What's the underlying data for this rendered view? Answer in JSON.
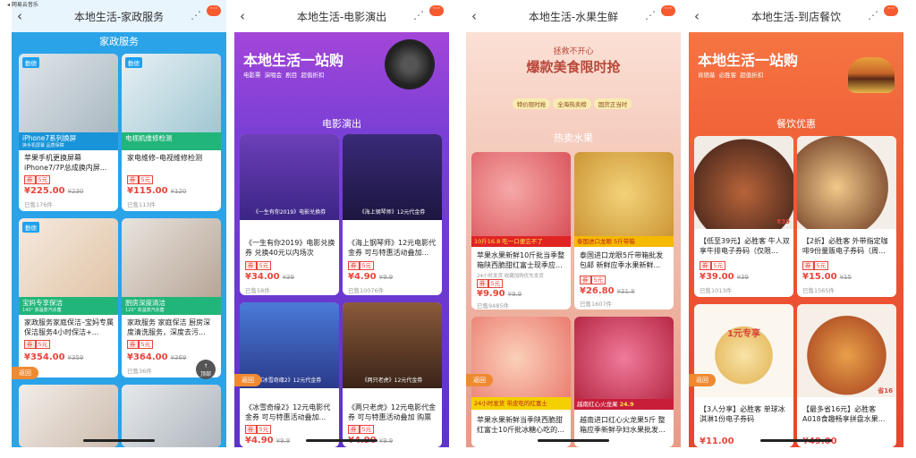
{
  "status_bar": "◂ 网易云音乐",
  "nav_icons": {
    "back": "chevron-left-icon",
    "share": "share-icon",
    "more": "more-icon"
  },
  "common": {
    "back_label": "返回",
    "top_label": "顶部",
    "voucher_tag": "券",
    "voucher_value": "5元"
  },
  "panels": [
    {
      "title": "本地生活-家政服务",
      "section": "家政服务",
      "cards": [
        {
          "bar": "iPhone7系列换屏",
          "bar_sub": "换手机屏幕 品质保障",
          "badge": "勤德",
          "title": "苹果手机更换屏幕iPhone7/7P总成换内屏...",
          "price": "¥225.00",
          "old": "¥230",
          "sold": "已售176件"
        },
        {
          "bar": "电视机维修检测",
          "bar_sub": "",
          "badge": "勤德",
          "title": "家电维修–电视维修检测",
          "price": "¥115.00",
          "old": "¥120",
          "sold": "已售113件"
        },
        {
          "bar": "宝妈专享保洁",
          "bar_sub": "140° 高温蒸汽杀菌",
          "badge": "勤德",
          "title": "家政服务家庭保洁–宝妈专属保洁服务4小时保洁+...",
          "price": "¥354.00",
          "old": "¥359",
          "sold": ""
        },
        {
          "bar": "厨房深度清洁",
          "bar_sub": "120° 高温蒸汽杀菌",
          "badge": "",
          "title": "家政服务 家庭保洁 厨房深度清洗服务，深度去污...",
          "price": "¥364.00",
          "old": "¥369",
          "sold": "已售36件"
        }
      ]
    },
    {
      "title": "本地生活-电影演出",
      "banner": "本地生活一站购",
      "banner_tags": [
        "电影票",
        "演唱会",
        "剧目",
        "超值折扣"
      ],
      "section": "电影演出",
      "cards": [
        {
          "poster": "《一生有你2019》电影兑换券",
          "title": "《一生有你2019》电影兑换券 兑换40元以内场次",
          "price": "¥34.00",
          "old": "¥39",
          "sold": "已售58件"
        },
        {
          "poster": "《海上钢琴师》12元代金券",
          "title": "《海上钢琴师》12元电影代金券 可与特惠活动叠加...",
          "price": "¥4.90",
          "old": "¥9.9",
          "sold": "已售10076件"
        },
        {
          "poster": "《冰雪奇缘2》12元代金券",
          "title": "《冰雪奇缘2》12元电影代金券 可与特惠活动叠加...",
          "price": "¥4.90",
          "old": "¥9.9",
          "sold": ""
        },
        {
          "poster": "《两只老虎》12元代金券",
          "title": "《两只老虎》12元电影代金券 可与特惠活动叠加 购票满...",
          "price": "¥4.90",
          "old": "¥9.9",
          "sold": ""
        }
      ]
    },
    {
      "title": "本地生活-水果生鲜",
      "banner_top": "拯救不开心",
      "banner": "爆款美食限时抢",
      "banner_tags": [
        "特价限时抢",
        "全海热卖榜",
        "国货正当时"
      ],
      "section": "热卖水果",
      "cards": [
        {
          "tag": "10斤16.8 吃一口便忘不了",
          "title": "苹果水果新鲜10斤批当季整箱陕西脆甜红富士现季应...",
          "note": "24小时发货 收藏加购优先发货",
          "price": "¥9.90",
          "old": "¥9.9",
          "sold": "已售9485件"
        },
        {
          "tag": "泰国进口龙眼 5斤带箱",
          "title": "泰国进口龙眼5斤带箱批发包邮 新鲜应季水果新鲜...",
          "note": "",
          "price": "¥26.80",
          "old": "¥31.8",
          "sold": "已售1607件"
        },
        {
          "tag": "24小时发货 带皮吃的红富士",
          "title": "苹果水果新鲜当季陕西脆甜红富士10斤批冰糖心吃的...",
          "note": "",
          "price": "",
          "old": "",
          "sold": ""
        },
        {
          "tag": "越南红心火龙果",
          "title": "越南进口红心火龙果5斤 整箱应季新鲜孕妇水果批发...",
          "note": "",
          "price": "24.9",
          "old": "",
          "sold": ""
        }
      ]
    },
    {
      "title": "本地生活-到店餐饮",
      "banner": "本地生活一站购",
      "banner_tags": [
        "肯德基",
        "必胜客",
        "超值折扣"
      ],
      "section": "餐饮优惠",
      "cards": [
        {
          "tag": "¥39",
          "title": "【低至39元】必胜客 牛人双享牛排电子券码（仅限...",
          "price": "¥39.00",
          "old": "¥39",
          "sold": "已售1013件"
        },
        {
          "tag": "",
          "title": "【2折】必胜客 外带指定咖啡9份量贩电子券码（周...",
          "price": "¥15.00",
          "old": "¥15",
          "sold": "已售1565件"
        },
        {
          "tag": "1元专享",
          "title": "【3人分享】必胜客 单球冰淇淋1份电子券码",
          "price": "¥11.00",
          "old": "",
          "sold": ""
        },
        {
          "tag": "省16",
          "title": "【最多省16元】必胜客 A018食趣畅享拼盘水果...",
          "price": "¥49.00",
          "old": "",
          "sold": ""
        }
      ]
    }
  ],
  "colors": {
    "blue": "#2aa3e8",
    "purple": "#7a3fd6",
    "fruit": "#f5d6c8",
    "food": "#ef5b35"
  }
}
